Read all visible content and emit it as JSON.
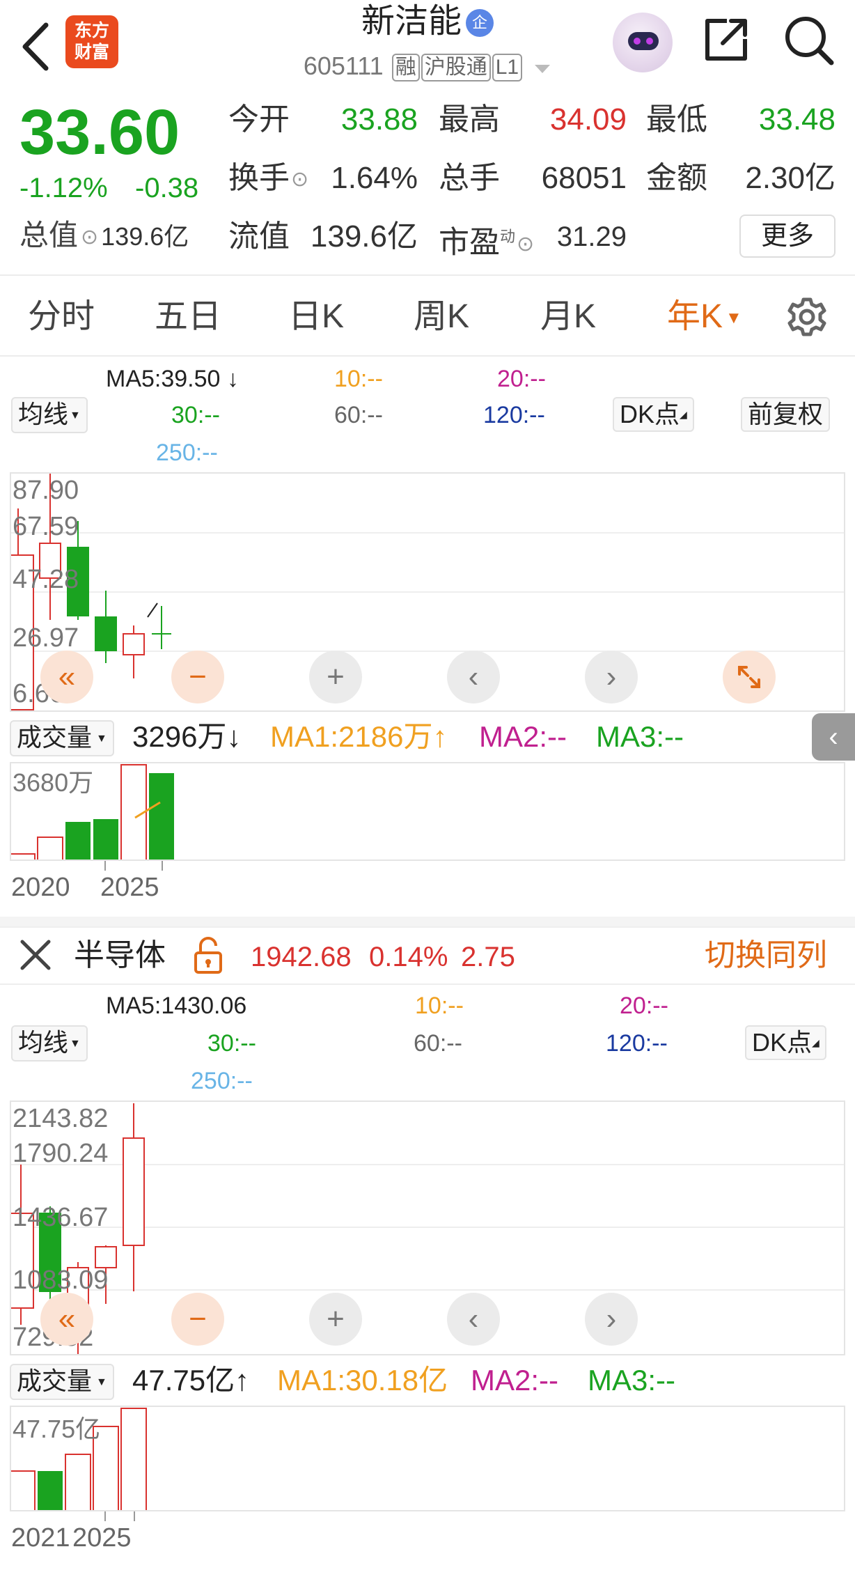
{
  "header": {
    "logo_line1": "东方",
    "logo_line2": "财富",
    "stock_name": "新洁能",
    "badge": "企",
    "code": "605111",
    "tags": [
      "融",
      "沪股通",
      "L1"
    ]
  },
  "quote": {
    "price": "33.60",
    "change_pct": "-1.12%",
    "change_amt": "-0.38",
    "open_label": "今开",
    "open": "33.88",
    "high_label": "最高",
    "high": "34.09",
    "low_label": "最低",
    "low": "33.48",
    "turnover_label": "换手",
    "turnover": "1.64%",
    "volume_label": "总手",
    "volume": "68051",
    "amount_label": "金额",
    "amount": "2.30亿",
    "mktcap_label": "总值",
    "mktcap": "139.6亿",
    "float_label": "流值",
    "float": "139.6亿",
    "pe_label": "市盈",
    "pe_sup": "动",
    "pe": "31.29",
    "more": "更多"
  },
  "tabs": [
    "分时",
    "五日",
    "日K",
    "周K",
    "月K",
    "年K"
  ],
  "colors": {
    "red": "#d9322f",
    "green": "#1aa320",
    "accent": "#e06a17",
    "ma5": "#222222",
    "ma10": "#f0a020",
    "ma20": "#c0208f",
    "ma30": "#1aa320",
    "ma60": "#666666",
    "ma120": "#1a3aa0",
    "ma250": "#68b4e6"
  },
  "main_chart": {
    "indicator": "均线",
    "ma5": "MA5:39.50",
    "ma10": "10:--",
    "ma20": "20:--",
    "ma30": "30:--",
    "ma60": "60:--",
    "ma120": "120:--",
    "ma250": "250:--",
    "dk": "DK点",
    "adjust": "前复权",
    "y_labels": [
      "87.90",
      "67.59",
      "47.28",
      "26.97",
      "6.66"
    ],
    "volume": {
      "indicator": "成交量",
      "value": "3296万",
      "ma1": "MA1:2186万",
      "ma2": "MA2:--",
      "ma3": "MA3:--",
      "max_label": "3680万",
      "x_labels": [
        "2020",
        "2025"
      ]
    }
  },
  "sector": {
    "name": "半导体",
    "price": "1942.68",
    "pct": "0.14%",
    "chg": "2.75",
    "switch": "切换同列"
  },
  "sector_chart": {
    "indicator": "均线",
    "ma5": "MA5:1430.06",
    "ma10": "10:--",
    "ma20": "20:--",
    "ma30": "30:--",
    "ma60": "60:--",
    "ma120": "120:--",
    "ma250": "250:--",
    "dk": "DK点",
    "y_labels": [
      "2143.82",
      "1790.24",
      "1436.67",
      "1083.09",
      "729.52"
    ],
    "volume": {
      "indicator": "成交量",
      "value": "47.75亿",
      "ma1": "MA1:30.18亿",
      "ma2": "MA2:--",
      "ma3": "MA3:--",
      "max_label": "47.75亿",
      "x_labels": [
        "2021",
        "2025"
      ]
    }
  }
}
